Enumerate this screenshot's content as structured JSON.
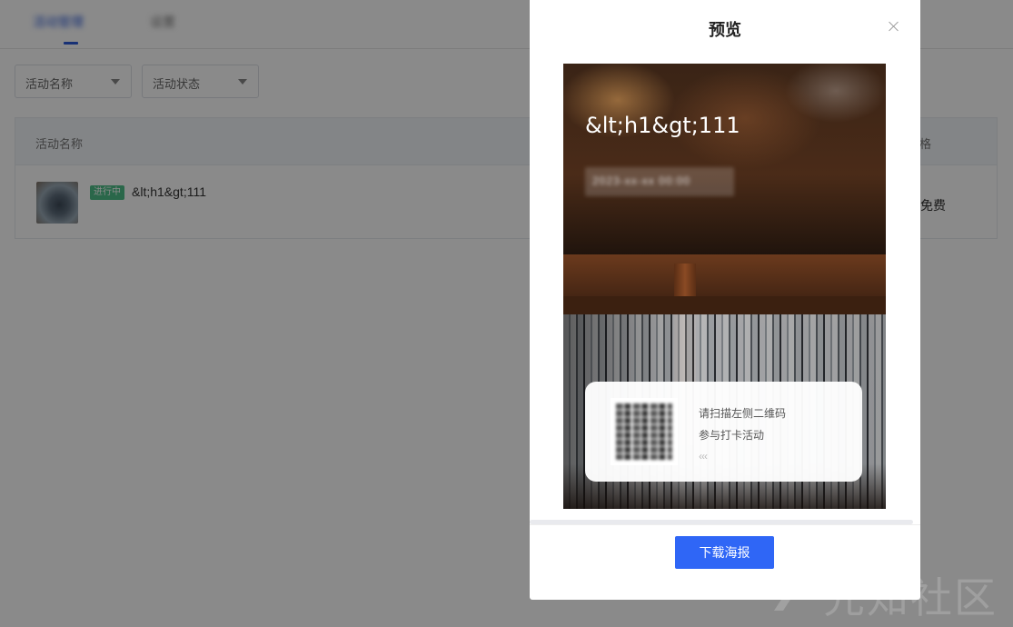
{
  "tabs": [
    {
      "label": "活动管理"
    },
    {
      "label": "设置"
    }
  ],
  "filters": {
    "activity_name": "活动名称",
    "activity_status": "活动状态"
  },
  "table": {
    "columns": {
      "name": "活动名称",
      "price": "价格"
    },
    "rows": [
      {
        "status": "进行中",
        "name": "&lt;h1&gt;111",
        "price": "免费"
      }
    ]
  },
  "modal": {
    "title": "预览",
    "poster": {
      "title": "&lt;h1&gt;111",
      "subtitle": "2023-xx-xx 00:00",
      "qr_line1": "请扫描左侧二维码",
      "qr_line2": "参与打卡活动",
      "qr_arrows": "‹‹‹"
    },
    "download_label": "下载海报"
  },
  "watermark": "先知社区",
  "colors": {
    "primary": "#2f66f6",
    "badge_green": "#4fbf8a",
    "mask": "rgba(0,0,0,0.46)"
  }
}
